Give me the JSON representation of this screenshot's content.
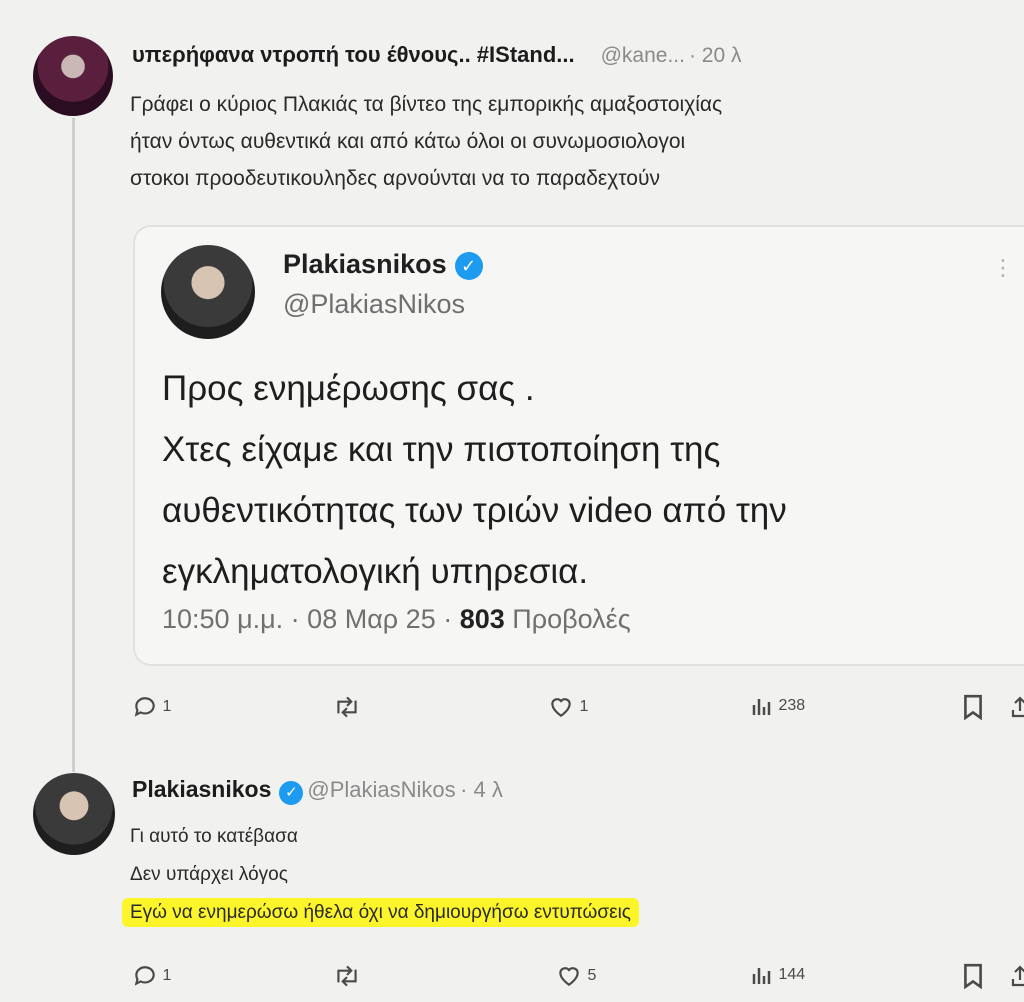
{
  "tweet1": {
    "name": "υπερήφανα ντροπή του έθνους.. #IStand...",
    "handle": "@kane...",
    "time": "· 20 λ",
    "body_lines": [
      "Γράφει ο κύριος Πλακιάς τα βίντεο της εμπορικής αμαξοστοιχίας",
      "ήταν όντως αυθεντικά και από κάτω όλοι οι συνωμοσιολογοι",
      "στοκοι προοδευτικουληδες αρνούνται να το παραδεχτούν"
    ],
    "actions": {
      "replies": "1",
      "likes": "1",
      "views": "238"
    }
  },
  "quote": {
    "name": "Plakiasnikos",
    "handle": "@PlakiasNikos",
    "more": "⋮",
    "body_lines": [
      "Προς ενημέρωσης σας .",
      "Χτες είχαμε και την πιστοποίηση της",
      "αυθεντικότητας των τριών video από την",
      "εγκληματολογική υπηρεσια."
    ],
    "meta_prefix": "10:50 μ.μ. · 08 Μαρ 25 · ",
    "views_count": "803",
    "views_label": " Προβολές"
  },
  "tweet2": {
    "name": "Plakiasnikos",
    "handle": "@PlakiasNikos",
    "time": "· 4 λ",
    "body_lines": [
      "Γι αυτό το κατέβασα",
      "Δεν υπάρχει λόγος"
    ],
    "highlighted_line": "Εγώ να ενημερώσω ήθελα όχι να δημιουργήσω εντυπώσεις",
    "actions": {
      "replies": "1",
      "likes": "5",
      "views": "144"
    }
  },
  "colors": {
    "verified": "#1d9bf0",
    "highlight": "#fbf52a",
    "background": "#f1f1ef"
  },
  "icons": [
    "reply-icon",
    "retweet-icon",
    "like-icon",
    "views-icon",
    "bookmark-icon",
    "share-icon",
    "verified-badge-icon",
    "more-icon"
  ]
}
